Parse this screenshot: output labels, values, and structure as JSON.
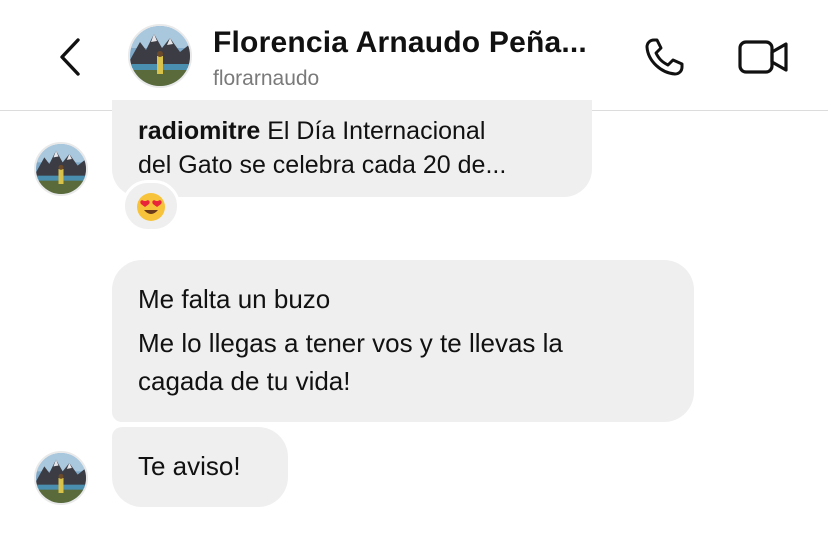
{
  "header": {
    "back_icon": "chevron-left-icon",
    "title": "Florencia Arnaudo Peña...",
    "subtitle": "florarnaudo",
    "call_icon": "phone-icon",
    "video_icon": "video-camera-icon"
  },
  "messages": {
    "shared_post": {
      "username": "radiomitre",
      "caption_line1": " El Día Internacional",
      "caption_line2": "del Gato se celebra cada 20 de..."
    },
    "reaction": {
      "emoji_icon": "heart-eyes-emoji-icon"
    },
    "bubble1": {
      "line1": "Me falta un buzo",
      "line2": "Me lo llegas a tener vos y te llevas la",
      "line3": "cagada de tu vida!"
    },
    "bubble2": {
      "text": "Te aviso!"
    }
  },
  "colors": {
    "bubble_bg": "#efefef",
    "text": "#111111",
    "subtitle": "#7a7a7a",
    "divider": "#dcdcdc"
  }
}
